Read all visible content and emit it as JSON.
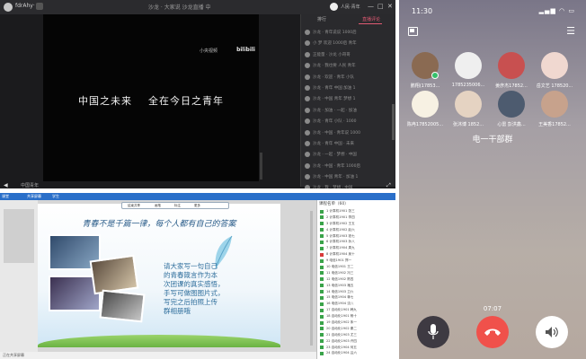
{
  "stream": {
    "title_name": "fdrAhy·",
    "title_center": "沙龙 · 大家说 沙龙直播 中",
    "window_controls": [
      "—",
      "□",
      "✕"
    ],
    "user_name": "人民·青年",
    "caption": "中国之未来    全在今日之青年",
    "logo_text": "小央视频",
    "logo_bili": "bilibili",
    "chat_tabs": [
      "排行",
      "直播评论"
    ],
    "chat_messages": [
      "沙龙 · 青年说说 1000后",
      "小 梦 欢迎 1000后 青年",
      "正能量 · 沙龙 小哥哥",
      "沙龙 · 我也要 人民 青年",
      "沙龙 · 欢迎 · 青年 小队",
      "沙龙 · 青年 中国 加油 1",
      "沙龙 · 中国 青年 梦想 1",
      "沙龙 · 加油 · 一起 · 加油",
      "沙龙 · 青年 小队 · 1000",
      "沙龙 · 中国 · 青年说 1000",
      "沙龙 · 青年 中国 · 未来",
      "沙龙 · 一起 · 梦想 · 中国",
      "沙龙 · 中国 · 青年 1000后",
      "沙龙 · 中国 青年 · 加油 1",
      "沙龙 · 我 · 梦想 · 中国",
      "沙龙 · 中国 · 青年 · 1000",
      "沙龙 · 一起 加油 青年",
      "沙龙 · 青年 · 未来 · 中国"
    ],
    "bottom_label": "中国青年"
  },
  "classwin": {
    "bar_items": [
      "课堂",
      "共享屏幕",
      "学生"
    ],
    "toolbar_items": [
      "结束共享",
      "画笔",
      "标注",
      "更多"
    ],
    "slide_title": "青春不是千篇一律，每个人都有自己的答案",
    "slide_body": [
      "请大家写一句自己",
      "的青春箴言作为本",
      "次团课的真实感悟，",
      "手写可做图图片式，",
      "写完之后拍照上传",
      "群相册哦"
    ],
    "roster_header": "课程名单（60）",
    "roster": [
      "1 计算机1901 张三",
      "2 计算机1901 李四",
      "3 计算机1902 王五",
      "4 计算机1902 赵六",
      "5 计算机1903 钱七",
      "6 计算机1903 孙八",
      "7 计算机1904 周九",
      "8 计算机1904 吴十",
      "9 电信1901 郑一",
      "10 电信1901 王二",
      "11 电信1902 冯三",
      "12 电信1902 陈四",
      "13 电信1903 褚五",
      "14 电信1903 卫六",
      "15 电信1904 蒋七",
      "16 电信1904 沈八",
      "17 自动化1901 韩九",
      "18 自动化1901 杨十",
      "19 自动化1902 朱一",
      "20 自动化1902 秦二",
      "21 自动化1903 尤三",
      "22 自动化1903 许四",
      "23 自动化1904 何五",
      "24 自动化1904 吕六"
    ],
    "footer_text": "正在共享屏幕"
  },
  "phone": {
    "time": "11:30",
    "status_icons": "▂▄▆ ◠ ▭",
    "group_name": "电一干部群",
    "call_time": "07:07",
    "members": [
      {
        "name": "鹏翔(17853...",
        "color": "#8a6a52",
        "speaking": true
      },
      {
        "name": "1785235006...",
        "color": "#efefef",
        "speaking": false
      },
      {
        "name": "姜彦杰17852...",
        "color": "#c85050",
        "speaking": false
      },
      {
        "name": "岳文艺 178520...",
        "color": "#f0d8d0",
        "speaking": false
      },
      {
        "name": "陈冉17852005...",
        "color": "#f7f1e3",
        "speaking": false
      },
      {
        "name": "张沐博 1852...",
        "color": "#e5d3c2",
        "speaking": false
      },
      {
        "name": "心雷 彭洪鑫...",
        "color": "#4d5b6f",
        "speaking": false
      },
      {
        "name": "王美香17852...",
        "color": "#c7a28c",
        "speaking": false
      }
    ],
    "colors": {
      "hangup": "#f0514b",
      "speaking": "#36c06b"
    }
  }
}
